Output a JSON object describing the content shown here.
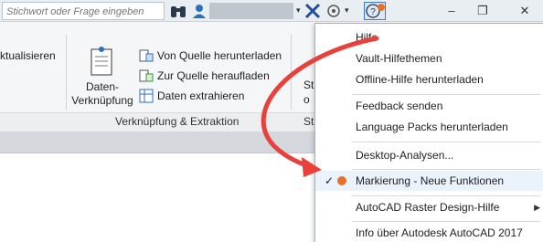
{
  "topbar": {
    "search_placeholder": "Stichwort oder Frage eingeben",
    "icons": [
      "binoculars-icon",
      "user-icon",
      "x-icon",
      "connect-icon",
      "help-icon"
    ],
    "window_buttons": [
      "–",
      "❐",
      "✕"
    ]
  },
  "ribbon": {
    "left_cut_label": "ktualisieren",
    "data_link": {
      "label_line1": "Daten-",
      "label_line2": "Verknüpfung"
    },
    "small_buttons": [
      "Von Quelle herunterladen",
      "Zur Quelle heraufladen",
      "Daten  extrahieren"
    ],
    "group_title": "Verknüpfung & Extraktion",
    "right_cut_label_top": "St",
    "right_cut_label_mid": "o",
    "right_cut_group": "Sta"
  },
  "menu": {
    "items": [
      {
        "label": "Hilfe"
      },
      {
        "label": "Vault-Hilfethemen"
      },
      {
        "label": "Offline-Hilfe herunterladen"
      },
      {
        "label": "Feedback senden"
      },
      {
        "label": "Language Packs herunterladen"
      },
      {
        "label": "Desktop-Analysen..."
      },
      {
        "label": "Markierung - Neue Funktionen"
      },
      {
        "label": "AutoCAD Raster Design-Hilfe"
      },
      {
        "label": "Info über Autodesk AutoCAD 2017"
      }
    ],
    "check_mark": "✓"
  },
  "colors": {
    "accent_orange": "#e8702a",
    "arrow_red": "#e8403a",
    "help_blue": "#3a7bd5"
  }
}
